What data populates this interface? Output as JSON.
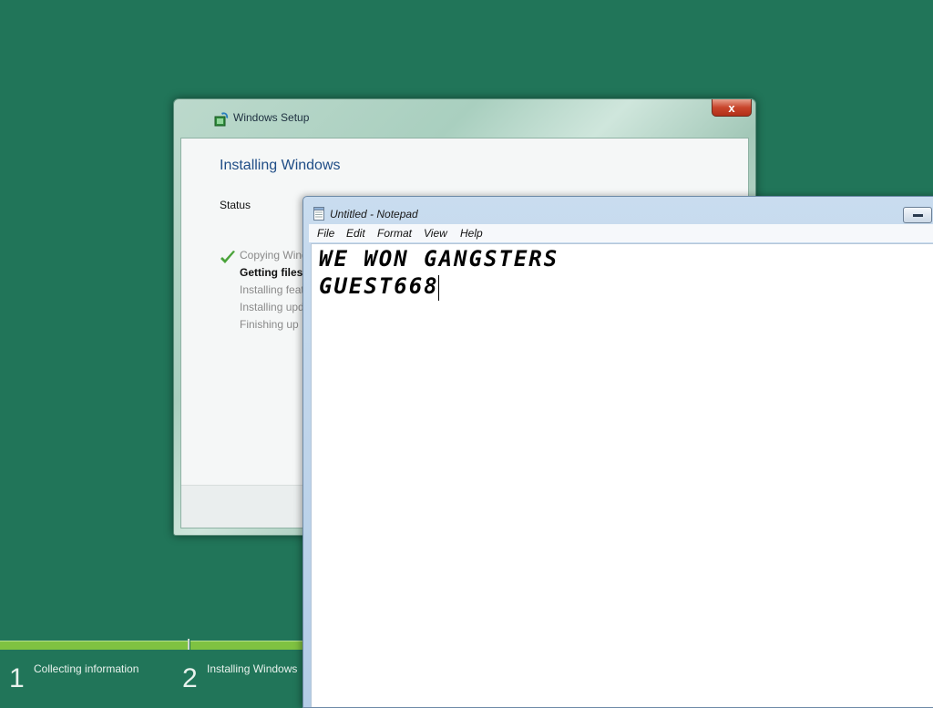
{
  "setup": {
    "title": "Windows Setup",
    "heading": "Installing Windows",
    "status_label": "Status",
    "steps": [
      {
        "label": "Copying Windows files",
        "state": "done"
      },
      {
        "label": "Getting files ready for installation",
        "state": "active"
      },
      {
        "label": "Installing features",
        "state": "pending"
      },
      {
        "label": "Installing updates",
        "state": "pending"
      },
      {
        "label": "Finishing up",
        "state": "pending"
      }
    ],
    "close_label": "x"
  },
  "progress": {
    "stages": [
      {
        "number": "1",
        "label": "Collecting information"
      },
      {
        "number": "2",
        "label": "Installing Windows"
      }
    ]
  },
  "notepad": {
    "title": "Untitled - Notepad",
    "menu": [
      "File",
      "Edit",
      "Format",
      "View",
      "Help"
    ],
    "content_lines": [
      "WE WON GANGSTERS",
      "GUEST668"
    ]
  },
  "colors": {
    "desktop": "#217559",
    "progress_green": "#7fc241",
    "heading_blue": "#1f4d86"
  }
}
